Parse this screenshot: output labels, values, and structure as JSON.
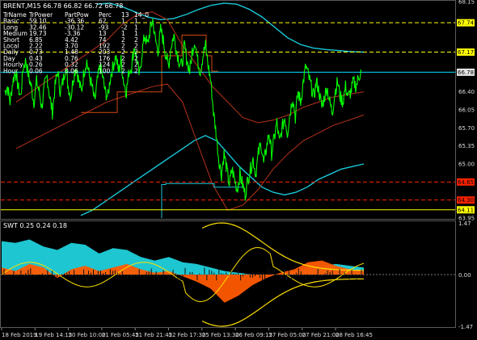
{
  "main_title": "BRENT,M15  66.78 66.82 66.72 66.78",
  "sub_title": "SWT 0.25 0.24 0.18",
  "colors": {
    "price": "#00ff00",
    "cyan_band": "#19c8d8",
    "brown_band": "#b8321a",
    "orange_step": "#d24a10",
    "yellow_hline": "#ffff00",
    "red_hline": "#ff2200",
    "cyan_hline": "#00e5ff",
    "fill_cyan": "#1fd1dc",
    "fill_orange": "#ff5a00",
    "ind_yellow": "#ffe000"
  },
  "table": {
    "headers": [
      "TrName",
      "TrPower",
      "PartPow",
      "Perc",
      "13",
      "14_0"
    ],
    "rows": [
      [
        "Basic",
        "59.10",
        "-36.36",
        "62",
        "1",
        "1"
      ],
      [
        "Long",
        "32.46",
        "-30.12",
        "-93",
        "-2",
        "1"
      ],
      [
        "Medium",
        "19.73",
        "-3.36",
        "13",
        "1",
        "1"
      ],
      [
        "Short",
        "6.85",
        "4.42",
        "74",
        "2",
        "2"
      ],
      [
        "Local",
        "2.22",
        "3.70",
        "192",
        "2",
        "2"
      ],
      [
        "Daily",
        "0.73",
        "1.48",
        "203",
        "2",
        "2"
      ],
      [
        "Day",
        "0.43",
        "0.76",
        "176",
        "2",
        "2"
      ],
      [
        "Hourly",
        "0.26",
        "0.32",
        "124",
        "2",
        "2"
      ],
      [
        "Hour",
        "0.06",
        "0.06",
        "100",
        "2",
        "2"
      ],
      [
        "",
        "",
        "",
        "",
        "",
        ""
      ]
    ]
  },
  "chart_data": {
    "type": "line",
    "main": {
      "ylim": [
        63.95,
        68.15
      ],
      "y_ticks": [
        "68.15",
        "67.74",
        "67.17",
        "66.78",
        "66.40",
        "66.05",
        "65.70",
        "65.35",
        "65.00",
        "64.65",
        "64.30",
        "64.11",
        "63.95"
      ],
      "price_series": [
        66.4,
        66.5,
        66.2,
        66.6,
        66.8,
        66.5,
        66.3,
        66.9,
        67.0,
        66.7,
        66.5,
        66.2,
        66.6,
        66.4,
        66.1,
        66.5,
        66.7,
        66.3,
        66.0,
        66.5,
        66.8,
        66.4,
        66.6,
        66.9,
        66.5,
        66.3,
        66.7,
        66.9,
        66.6,
        66.4,
        66.8,
        67.0,
        66.7,
        66.5,
        66.2,
        66.6,
        66.9,
        66.7,
        66.4,
        66.3,
        66.7,
        66.9,
        67.1,
        66.8,
        67.0,
        66.6,
        66.4,
        66.8,
        66.9,
        67.3,
        67.0,
        66.7,
        67.2,
        67.5,
        67.3,
        67.6,
        67.8,
        67.4,
        67.2,
        67.6,
        67.4,
        67.1,
        66.9,
        67.3,
        67.5,
        67.2,
        67.0,
        66.9,
        67.3,
        67.0,
        66.8,
        67.2,
        67.4,
        67.0,
        66.8,
        67.1,
        67.3,
        66.9,
        66.6,
        66.0,
        65.6,
        65.1,
        64.8,
        65.2,
        64.9,
        64.6,
        64.9,
        64.7,
        64.5,
        64.8,
        64.6,
        64.4,
        64.7,
        64.9,
        65.1,
        64.8,
        65.2,
        65.4,
        65.0,
        65.3,
        65.6,
        65.2,
        65.5,
        65.8,
        65.4,
        65.7,
        65.9,
        65.6,
        66.0,
        66.3,
        65.9,
        66.4,
        66.2,
        66.6,
        66.9,
        66.7,
        66.5,
        66.3,
        66.6,
        66.4,
        66.1,
        66.3,
        66.5,
        66.2,
        66.0,
        66.4,
        66.6,
        66.3,
        66.2,
        66.5,
        66.3,
        66.4,
        66.6,
        66.5,
        66.7,
        66.8
      ],
      "cyan_band": [
        64.0,
        64.1,
        64.25,
        64.4,
        64.55,
        64.7,
        64.85,
        65.0,
        65.15,
        65.3,
        65.45,
        65.55,
        65.45,
        65.2,
        64.95,
        64.75,
        64.55,
        64.45,
        64.4,
        64.45,
        64.55,
        64.7,
        64.8,
        64.9,
        64.95,
        65.0
      ],
      "upper_cyan": [
        68.1,
        68.12,
        68.05,
        67.95,
        67.85,
        67.8,
        67.82,
        67.9,
        68.0,
        68.08,
        68.12,
        68.1,
        68.0,
        67.85,
        67.65,
        67.45,
        67.32,
        67.25,
        67.22,
        67.2,
        67.18,
        67.17
      ],
      "brown_upper": [
        66.2,
        66.4,
        66.6,
        66.8,
        67.0,
        67.2,
        67.4,
        67.7,
        67.9,
        67.95,
        67.8,
        67.3,
        66.9,
        66.5,
        66.2,
        65.9,
        65.8,
        65.85,
        65.95,
        66.1,
        66.2,
        66.3,
        66.35,
        66.4
      ],
      "brown_lower": [
        65.3,
        65.45,
        65.6,
        65.75,
        65.9,
        66.05,
        66.2,
        66.3,
        66.4,
        66.5,
        66.55,
        66.2,
        65.4,
        64.6,
        64.1,
        64.2,
        64.5,
        64.9,
        65.2,
        65.45,
        65.6,
        65.75,
        65.85,
        65.95
      ],
      "hlines": [
        {
          "value": 67.74,
          "color": "yellow",
          "style": "dashed",
          "label": "67.74"
        },
        {
          "value": 67.17,
          "color": "yellow",
          "style": "dashed",
          "label": "67.17"
        },
        {
          "value": 66.78,
          "color": "cyan",
          "style": "solid",
          "label": "66.78"
        },
        {
          "value": 64.65,
          "color": "red",
          "style": "dashed",
          "label": "64.65"
        },
        {
          "value": 64.3,
          "color": "red",
          "style": "dashed",
          "label": "64.30"
        },
        {
          "value": 64.11,
          "color": "yellow",
          "style": "solid",
          "label": "64.11"
        }
      ]
    },
    "sub": {
      "ylim": [
        -1.47,
        1.47
      ],
      "y_ticks": [
        "1.47",
        "0.00",
        "-1.47"
      ],
      "cyan_fill_upper": [
        0.95,
        0.9,
        1.0,
        0.8,
        0.7,
        0.9,
        0.85,
        0.6,
        0.75,
        0.7,
        0.5,
        0.4,
        0.5,
        0.35,
        0.3,
        0.2,
        0.1,
        0.05,
        0.0,
        0.0,
        0.0,
        0.1,
        0.2,
        0.25,
        0.3,
        0.25,
        0.2
      ],
      "orange_fill": [
        0.2,
        0.1,
        0.3,
        0.2,
        -0.1,
        0.15,
        0.25,
        0.1,
        0.2,
        0.3,
        0.15,
        0.05,
        0.1,
        -0.05,
        -0.2,
        -0.4,
        -0.8,
        -0.6,
        -0.3,
        -0.1,
        0.05,
        0.15,
        0.35,
        0.4,
        0.25,
        0.15,
        0.1
      ],
      "x_labels": [
        "18 Feb 2019",
        "19 Feb 14:15",
        "20 Feb 10:00",
        "21 Feb 05:45",
        "21 Feb 21:45",
        "22 Feb 17:30",
        "25 Feb 13:30",
        "26 Feb 09:15",
        "27 Feb 05:00",
        "27 Feb 21:00",
        "28 Feb 16:45"
      ]
    }
  }
}
